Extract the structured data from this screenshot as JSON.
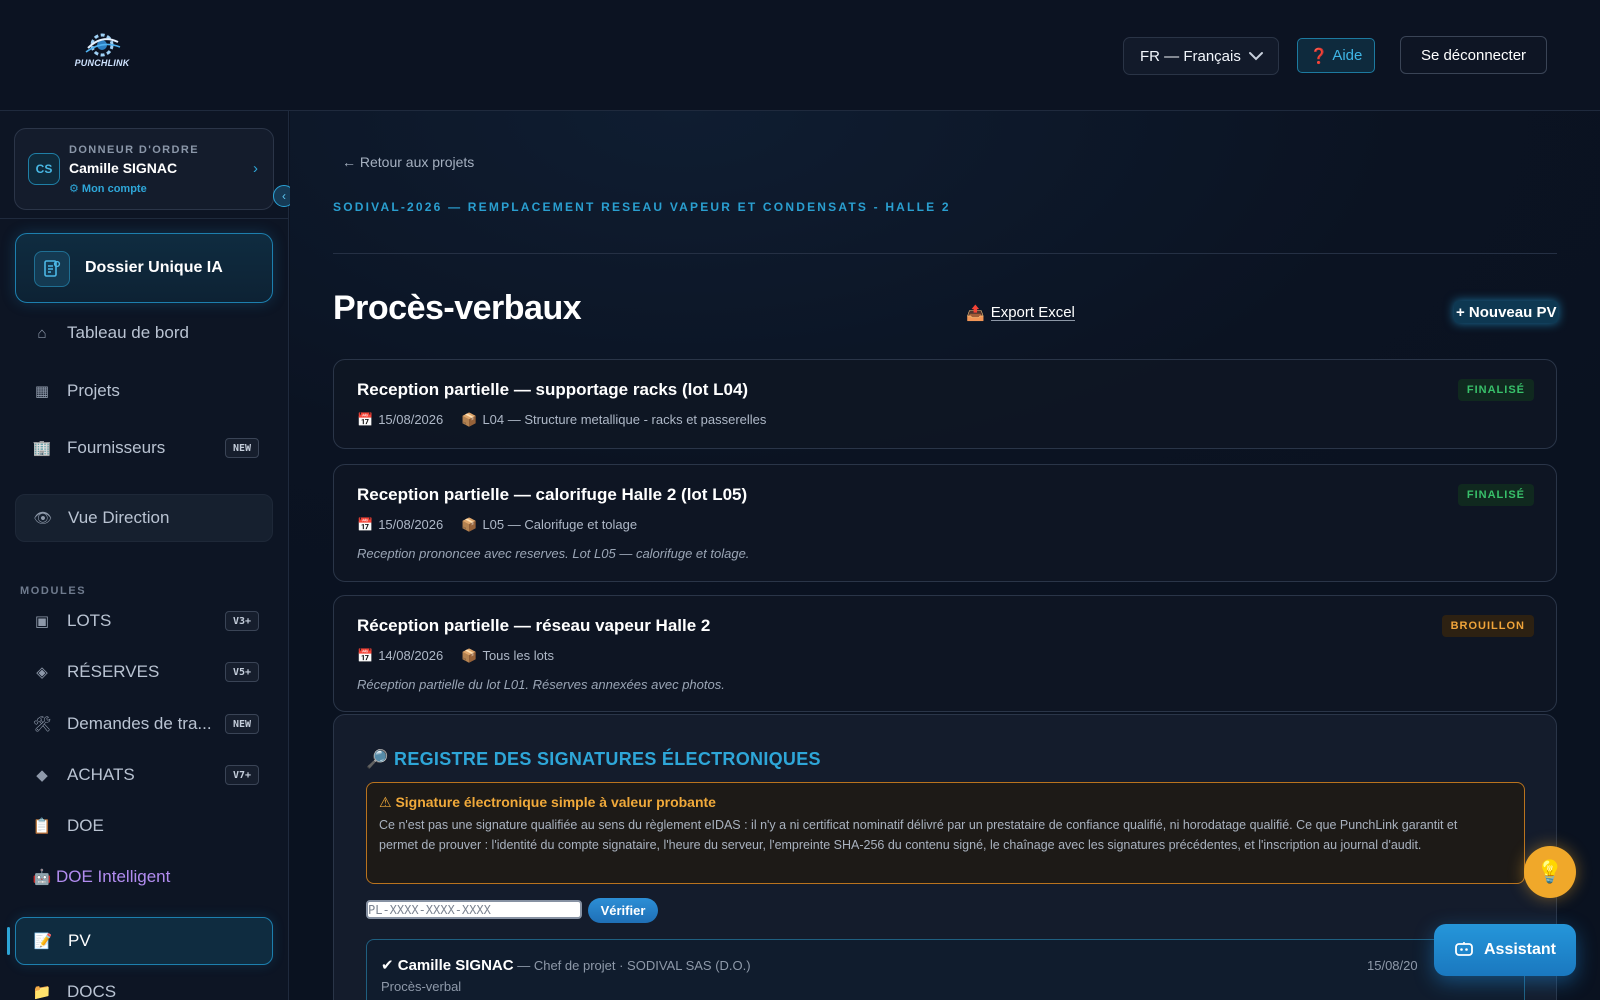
{
  "brand": {
    "logo_text": "PUNCHLINK"
  },
  "header": {
    "language": "FR — Français",
    "help_label": "Aide",
    "logout_label": "Se déconnecter"
  },
  "account": {
    "initials": "CS",
    "role": "DONNEUR D'ORDRE",
    "name": "Camille SIGNAC",
    "link": "⚙ Mon compte"
  },
  "sidebar": {
    "dossier": "Dossier Unique IA",
    "items": [
      {
        "label": "Tableau de bord",
        "icon": "home-icon"
      },
      {
        "label": "Projets",
        "icon": "grid-icon"
      },
      {
        "label": "Fournisseurs",
        "icon": "building-icon",
        "badge": "NEW"
      },
      {
        "label": "Vue Direction",
        "icon": "eye-icon"
      }
    ],
    "modules_label": "MODULES",
    "modules": [
      {
        "label": "LOTS",
        "icon": "square-icon",
        "badge": "V3+"
      },
      {
        "label": "RÉSERVES",
        "icon": "diamond-outline-icon",
        "badge": "V5+"
      },
      {
        "label": "Demandes de tra...",
        "icon": "tools-icon",
        "badge": "NEW"
      },
      {
        "label": "ACHATS",
        "icon": "diamond-icon",
        "badge": "V7+"
      },
      {
        "label": "DOE",
        "icon": "clipboard-icon"
      },
      {
        "label": "DOE Intelligent",
        "icon": "robot-icon"
      },
      {
        "label": "PV",
        "icon": "memo-icon"
      },
      {
        "label": "DOCS",
        "icon": "folder-icon"
      }
    ]
  },
  "main": {
    "back_link": "← Retour aux projets",
    "project_code": "SODIVAL-2026 — REMPLACEMENT RESEAU VAPEUR ET CONDENSATS - HALLE 2",
    "title": "Procès-verbaux",
    "export_label": "Export Excel",
    "new_pv_label": "+ Nouveau PV",
    "pvs": [
      {
        "title": "Reception partielle — supportage racks (lot L04)",
        "date": "15/08/2026",
        "lot": "L04 — Structure metallique - racks et passerelles",
        "note": "",
        "status": "FINALISÉ"
      },
      {
        "title": "Reception partielle — calorifuge Halle 2 (lot L05)",
        "date": "15/08/2026",
        "lot": "L05 — Calorifuge et tolage",
        "note": "Reception prononcee avec reserves. Lot L05 — calorifuge et tolage.",
        "status": "FINALISÉ"
      },
      {
        "title": "Réception partielle — réseau vapeur Halle 2",
        "date": "14/08/2026",
        "lot": "Tous les lots",
        "note": "Réception partielle du lot L01. Réserves annexées avec photos.",
        "status": "BROUILLON"
      }
    ]
  },
  "signatures": {
    "title": "REGISTRE DES SIGNATURES ÉLECTRONIQUES",
    "warning_title": "⚠ Signature électronique simple à valeur probante",
    "warning_text": "Ce n'est pas une signature qualifiée au sens du règlement eIDAS : il n'y a ni certificat nominatif délivré par un prestataire de confiance qualifié, ni horodatage qualifié. Ce que PunchLink garantit et permet de prouver : l'identité du compte signataire, l'heure du serveur, l'empreinte SHA-256 du contenu signé, le chaînage avec les signatures précédentes, et l'inscription au journal d'audit.",
    "verify_placeholder": "PL-XXXX-XXXX-XXXX",
    "verify_label": "Vérifier",
    "entry": {
      "name": "✔ Camille SIGNAC",
      "role": " — Chef de projet · SODIVAL SAS (D.O.)",
      "doc": "Procès-verbal",
      "date": "15/08/20"
    }
  },
  "floating": {
    "assistant_label": "Assistant"
  },
  "colors": {
    "accent": "#2ea6d8",
    "finalized": "#38c06a",
    "draft": "#f0a43a",
    "background": "#0b1220"
  }
}
